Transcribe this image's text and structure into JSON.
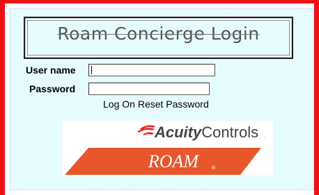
{
  "title": "Roam Concierge Login",
  "form": {
    "username_label": "User name",
    "username_value": "",
    "password_label": "Password",
    "password_value": ""
  },
  "links": {
    "log_on": "Log On",
    "reset_password": "Reset Password"
  },
  "logo": {
    "company": "AcuityControls",
    "company_bold": "Acuity",
    "company_light": "Controls",
    "product": "ROAM"
  },
  "colors": {
    "border": "#ee1111",
    "panel_bg": "#e6fbfd",
    "brand_orange": "#e8572c",
    "brand_red": "#e32b2b"
  }
}
